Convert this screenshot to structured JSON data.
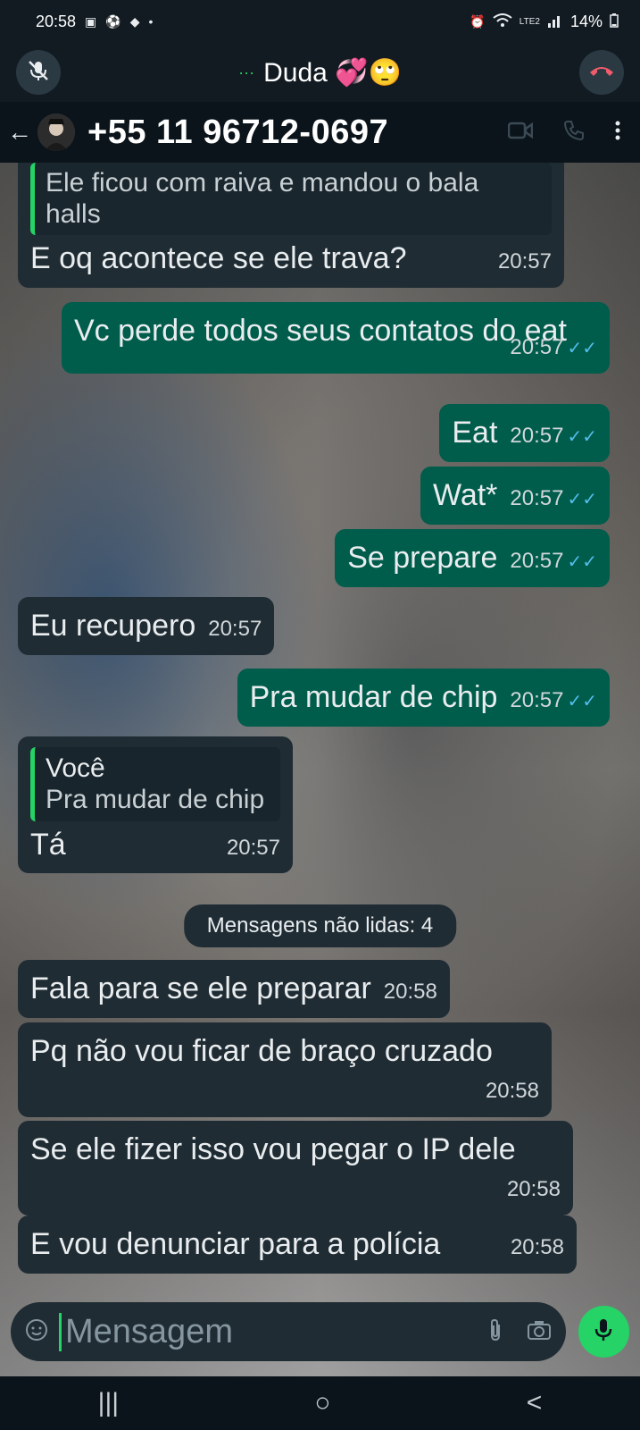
{
  "status": {
    "time": "20:58",
    "battery": "14%",
    "network": "LTE2"
  },
  "call": {
    "contact": "Duda 💞🙄",
    "status_dots": "···"
  },
  "header": {
    "phone": "+55 11 96712-0697"
  },
  "messages": [
    {
      "dir": "in",
      "quote_text": "Ele ficou com raiva e mandou o bala halls",
      "text": "E oq acontece se ele trava?",
      "time": "20:57"
    },
    {
      "dir": "out",
      "text": "Vc perde todos seus contatos do eat",
      "time": "20:57",
      "read": "✓✓"
    },
    {
      "dir": "out",
      "text": "Eat",
      "time": "20:57",
      "read": "✓✓"
    },
    {
      "dir": "out",
      "text": "Wat*",
      "time": "20:57",
      "read": "✓✓"
    },
    {
      "dir": "out",
      "text": "Se prepare",
      "time": "20:57",
      "read": "✓✓"
    },
    {
      "dir": "in",
      "text": "Eu recupero",
      "time": "20:57"
    },
    {
      "dir": "out",
      "text": "Pra mudar de chip",
      "time": "20:57",
      "read": "✓✓"
    },
    {
      "dir": "in",
      "quote_author": "Você",
      "quote_text": "Pra mudar de chip",
      "text": "Tá",
      "time": "20:57"
    },
    {
      "dir": "in",
      "text": "Fala para se ele preparar",
      "time": "20:58"
    },
    {
      "dir": "in",
      "text": "Pq não vou ficar de braço cruzado",
      "time": "20:58"
    },
    {
      "dir": "in",
      "text": "Se ele fizer isso vou pegar o IP dele",
      "time": "20:58"
    },
    {
      "dir": "in",
      "text": "E vou denunciar para a polícia",
      "time": "20:58"
    }
  ],
  "unread_label": "Mensagens não lidas: 4",
  "composer": {
    "placeholder": "Mensagem"
  },
  "nav": {
    "recents": "|||",
    "home": "○",
    "back": "<"
  },
  "colors": {
    "incoming": "#1f2c33",
    "outgoing": "#005c4b",
    "accent": "#25d366",
    "end_call": "#f15c6d",
    "read_ticks": "#53bdeb"
  }
}
